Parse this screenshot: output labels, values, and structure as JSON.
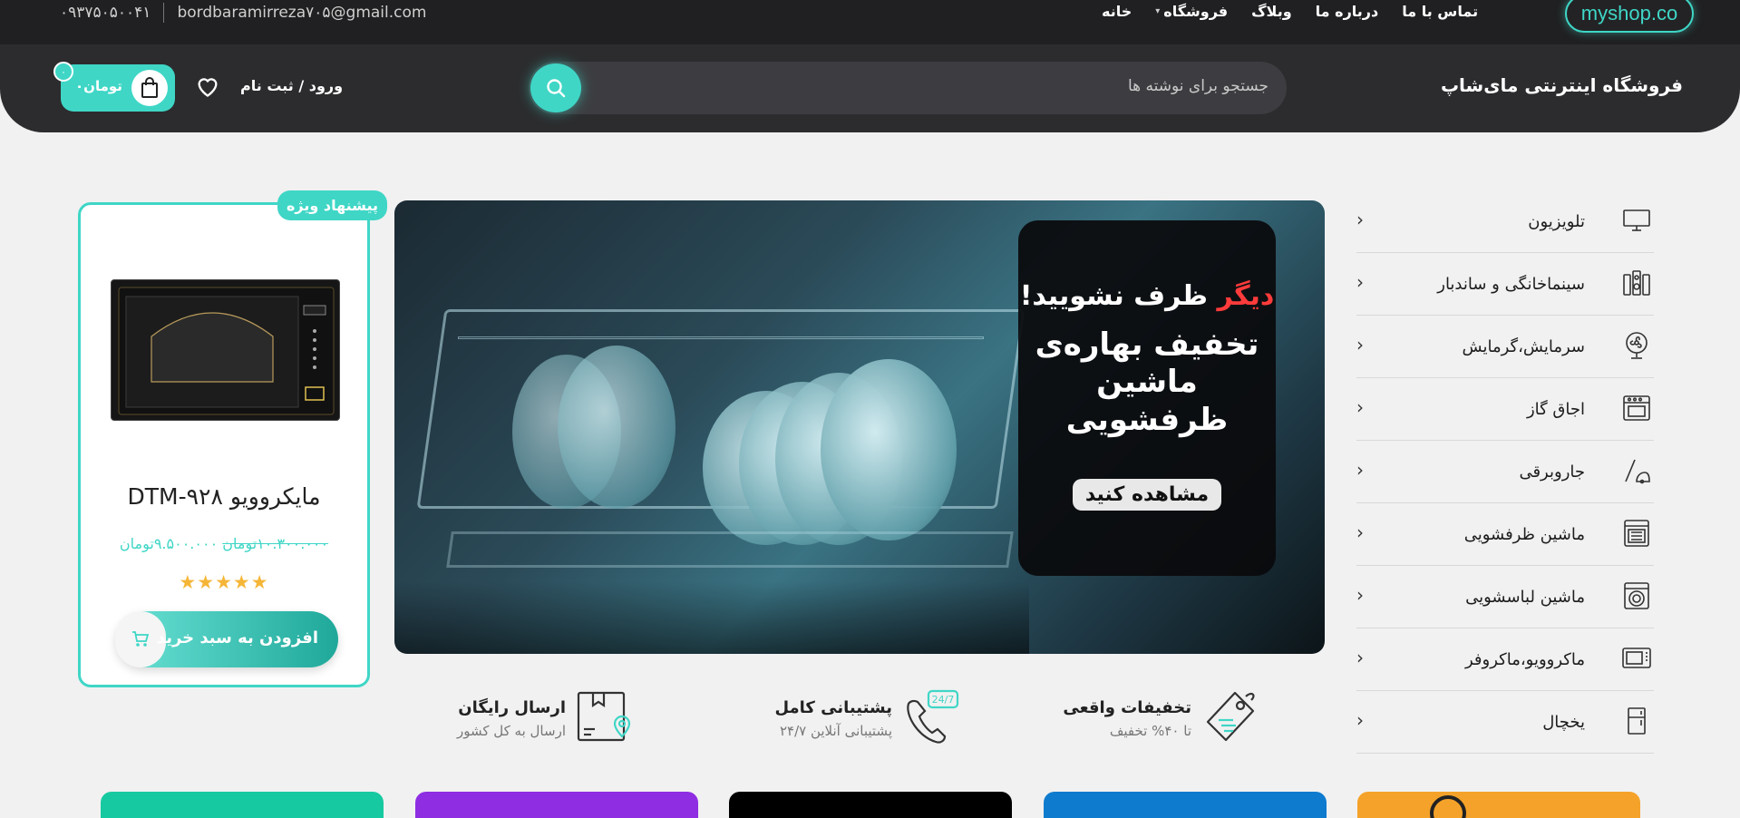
{
  "topbar": {
    "phone": "۰۹۳۷۵۰۵۰۰۴۱",
    "email": "bordbaramirreza۷۰۵@gmail.com",
    "nav": [
      "خانه",
      "فروشگاه",
      "وبلاگ",
      "درباره ما",
      "تماس با ما"
    ],
    "logo": "myshop.co"
  },
  "header": {
    "store_name": "فروشگاه اینترنتی مای‌شاپ",
    "search_placeholder": "جستجو برای نوشته ها",
    "login_label": "ورود / ثبت نام",
    "cart_amount": "۰تومان",
    "cart_count": "۰"
  },
  "categories": [
    {
      "label": "تلویزیون",
      "icon": "tv-icon"
    },
    {
      "label": "سینماخانگی و ساندبار",
      "icon": "speaker-icon"
    },
    {
      "label": "سرمایش،گرمایش",
      "icon": "fan-icon"
    },
    {
      "label": "اجاق گاز",
      "icon": "stove-icon"
    },
    {
      "label": "جاروبرقی",
      "icon": "vacuum-icon"
    },
    {
      "label": "ماشین ظرفشویی",
      "icon": "dishwasher-icon"
    },
    {
      "label": "ماشین لباسشویی",
      "icon": "washing-machine-icon"
    },
    {
      "label": "ماکروویو،ماکروفر",
      "icon": "microwave-icon"
    },
    {
      "label": "یخچال",
      "icon": "fridge-icon"
    }
  ],
  "banner": {
    "line1_red": "دیگر",
    "line1": "ظرف نشویید!",
    "line2": "تخفیف بهاره‌ی",
    "line3": "ماشین ظرفشویی",
    "cta": "مشاهده کنید"
  },
  "features": [
    {
      "title": "تخفیفات واقعی",
      "subtitle": "تا ۴۰% تخفیف",
      "icon": "discount-tag-icon"
    },
    {
      "title": "پشتیبانی کامل",
      "subtitle": "پشتیبانی آنلاین ۲۴/۷",
      "icon": "support-247-icon"
    },
    {
      "title": "ارسال رایگان",
      "subtitle": "ارسال به کل کشور",
      "icon": "delivery-box-icon"
    }
  ],
  "offer": {
    "tag": "پیشنهاد ویژه",
    "name": "مایکروویو DTM-۹۲۸",
    "old_price": "۱۰.۳۰۰.۰۰۰تومان",
    "new_price": "۹.۵۰۰.۰۰۰تومان",
    "rating": 5,
    "add_to_cart": "افزودن به سبد خرید"
  },
  "colors": {
    "accent": "#3fd6c6",
    "header_bg": "#2c2c2e",
    "page_bg": "#f1f1f1",
    "banner_red": "#ff3b3b",
    "tile_colors": [
      "#17c9a0",
      "#8e2de2",
      "#000000",
      "#0f7bcf",
      "#f5a22a"
    ]
  }
}
